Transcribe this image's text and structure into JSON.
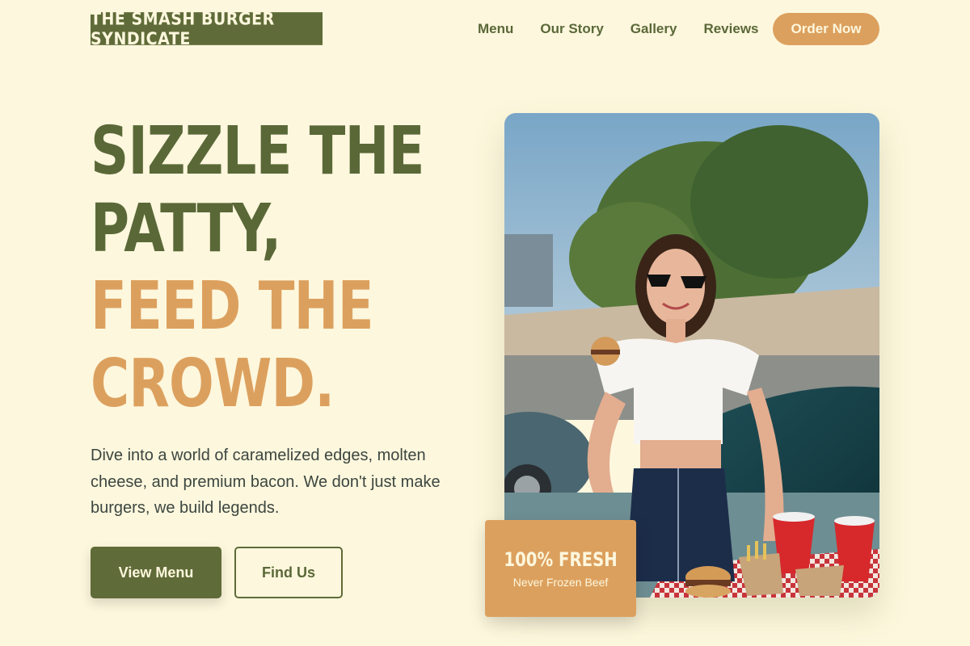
{
  "brand": {
    "name": "THE SMASH BURGER SYNDICATE"
  },
  "nav": {
    "links": [
      "Menu",
      "Our Story",
      "Gallery",
      "Reviews"
    ],
    "cta": "Order Now"
  },
  "hero": {
    "headline": [
      "SIZZLE THE",
      "PATTY,",
      "FEED THE",
      "CROWD."
    ],
    "description": "Dive into a world of caramelized edges, molten cheese, and premium bacon. We don't just make burgers, we build legends.",
    "primary_button": "View Menu",
    "secondary_button": "Find Us"
  },
  "badge": {
    "title": "100% FRESH",
    "subtitle": "Never Frozen Beef"
  },
  "colors": {
    "background": "#fdf7dd",
    "olive": "#5f6b38",
    "accent": "#dca05e",
    "text": "#3c4640"
  }
}
